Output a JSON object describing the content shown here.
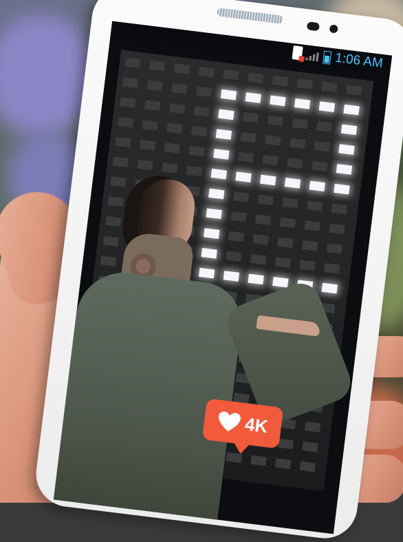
{
  "status_bar": {
    "time": "1:06 AM",
    "icons": [
      "sim-alert-icon",
      "signal-icon",
      "battery-icon"
    ],
    "accent_color": "#4fc3f7"
  },
  "like_badge": {
    "icon": "heart-icon",
    "count": "4K",
    "color": "#f15a3a"
  }
}
